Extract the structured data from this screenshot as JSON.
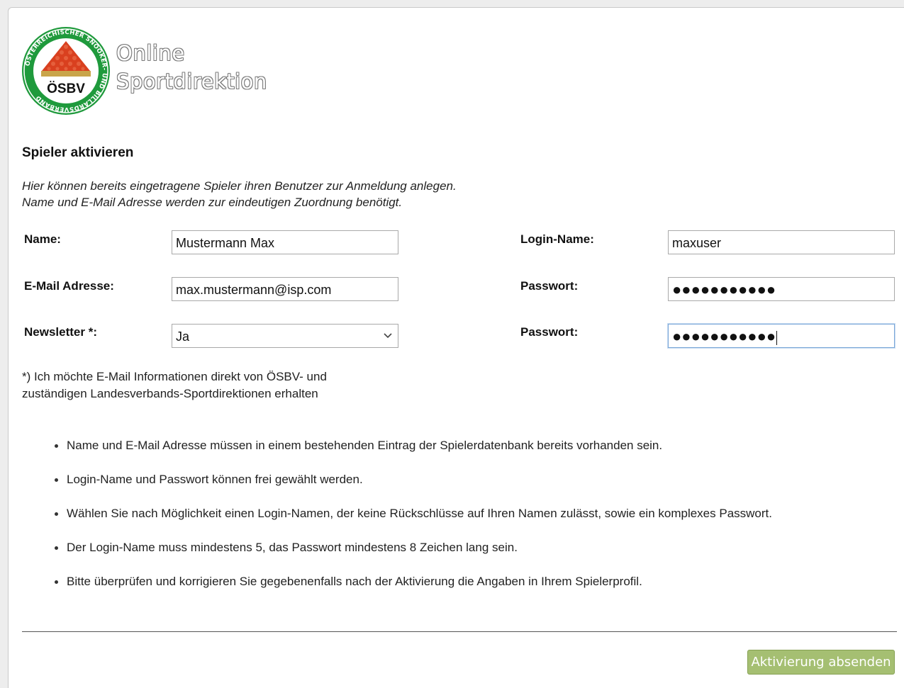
{
  "brand": {
    "line1": "Online",
    "line2": "Sportdirektion",
    "logo_text": "ÖSBV",
    "logo_ring_text": "ÖSTERREICHISCHER SNOOKER- UND BILLARDSVERBAND",
    "logo_colors": {
      "ring": "#1f9a3c",
      "ball": "#d9401f",
      "rack": "#c9a54a"
    }
  },
  "page": {
    "title": "Spieler aktivieren",
    "intro_line1": "Hier können bereits eingetragene Spieler ihren Benutzer zur Anmeldung anlegen.",
    "intro_line2": "Name und E-Mail Adresse werden zur eindeutigen Zuordnung benötigt."
  },
  "form": {
    "name_label": "Name:",
    "name_value": "Mustermann Max",
    "email_label": "E-Mail Adresse:",
    "email_value": "max.mustermann@isp.com",
    "newsletter_label": "Newsletter *:",
    "newsletter_value": "Ja",
    "login_label": "Login-Name:",
    "login_value": "maxuser",
    "password_label": "Passwort:",
    "password_masked": "●●●●●●●●●●●",
    "password_repeat_label": "Passwort:",
    "password_repeat_masked": "●●●●●●●●●●●"
  },
  "footnote": {
    "line1": "*) Ich möchte E-Mail Informationen direkt von ÖSBV- und",
    "line2": "zuständigen Landesverbands-Sportdirektionen erhalten"
  },
  "hints": [
    "Name und E-Mail Adresse müssen in einem bestehenden Eintrag der Spielerdatenbank bereits vorhanden sein.",
    "Login-Name und Passwort können frei gewählt werden.",
    "Wählen Sie nach Möglichkeit einen Login-Namen, der keine Rückschlüsse auf Ihren Namen zulässt, sowie ein komplexes Passwort.",
    "Der Login-Name muss mindestens 5, das Passwort mindestens 8 Zeichen lang sein.",
    "Bitte überprüfen und korrigieren Sie gegebenenfalls nach der Aktivierung die Angaben in Ihrem Spielerprofil."
  ],
  "actions": {
    "submit_label": "Aktivierung absenden",
    "submit_color": "#a5bf72"
  }
}
